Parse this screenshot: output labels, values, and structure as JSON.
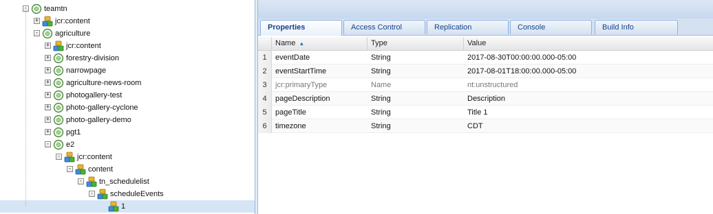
{
  "tree": {
    "nodes": [
      {
        "label": "teamtn",
        "expander": "-",
        "icon": "page-icon",
        "level": 0
      },
      {
        "label": "jcr:content",
        "expander": "+",
        "icon": "node-icon",
        "level": 1
      },
      {
        "label": "agriculture",
        "expander": "-",
        "icon": "page-icon",
        "level": 1
      },
      {
        "label": "jcr:content",
        "expander": "+",
        "icon": "node-icon",
        "level": 2
      },
      {
        "label": "forestry-division",
        "expander": "+",
        "icon": "page-icon",
        "level": 2
      },
      {
        "label": "narrowpage",
        "expander": "+",
        "icon": "page-icon",
        "level": 2
      },
      {
        "label": "agriculture-news-room",
        "expander": "+",
        "icon": "page-icon",
        "level": 2
      },
      {
        "label": "photogallery-test",
        "expander": "+",
        "icon": "page-icon",
        "level": 2
      },
      {
        "label": "photo-gallery-cyclone",
        "expander": "+",
        "icon": "page-icon",
        "level": 2
      },
      {
        "label": "photo-gallery-demo",
        "expander": "+",
        "icon": "page-icon",
        "level": 2
      },
      {
        "label": "pgt1",
        "expander": "+",
        "icon": "page-icon",
        "level": 2
      },
      {
        "label": "e2",
        "expander": "-",
        "icon": "page-icon",
        "level": 2
      },
      {
        "label": "jcr:content",
        "expander": "-",
        "icon": "node-icon",
        "level": 3
      },
      {
        "label": "content",
        "expander": "-",
        "icon": "node-icon",
        "level": 4
      },
      {
        "label": "tn_schedulelist",
        "expander": "-",
        "icon": "node-icon",
        "level": 5
      },
      {
        "label": "scheduleEvents",
        "expander": "-",
        "icon": "node-icon",
        "level": 6
      },
      {
        "label": "1",
        "expander": "",
        "icon": "node-icon",
        "level": 7,
        "selected": true
      }
    ]
  },
  "tabs": [
    {
      "label": "Properties",
      "active": true
    },
    {
      "label": "Access Control",
      "active": false
    },
    {
      "label": "Replication",
      "active": false
    },
    {
      "label": "Console",
      "active": false
    },
    {
      "label": "Build Info",
      "active": false
    }
  ],
  "grid": {
    "columns": {
      "name": "Name",
      "type": "Type",
      "value": "Value"
    },
    "sort_indicator": "▲",
    "rows": [
      {
        "num": "1",
        "name": "eventDate",
        "type": "String",
        "value": "2017-08-30T00:00:00.000-05:00",
        "muted": false
      },
      {
        "num": "2",
        "name": "eventStartTime",
        "type": "String",
        "value": "2017-08-01T18:00:00.000-05:00",
        "muted": false
      },
      {
        "num": "3",
        "name": "jcr:primaryType",
        "type": "Name",
        "value": "nt:unstructured",
        "muted": true
      },
      {
        "num": "4",
        "name": "pageDescription",
        "type": "String",
        "value": "Description",
        "muted": false
      },
      {
        "num": "5",
        "name": "pageTitle",
        "type": "String",
        "value": "Title 1",
        "muted": false
      },
      {
        "num": "6",
        "name": "timezone",
        "type": "String",
        "value": "CDT",
        "muted": false
      }
    ]
  },
  "colors": {
    "selection": "#d6e5f5",
    "tab_text": "#15428b",
    "header_blue": "#c7d8ee"
  }
}
